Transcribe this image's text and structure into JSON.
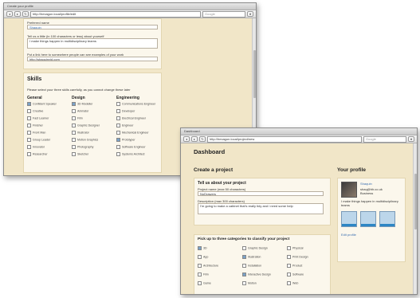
{
  "window1": {
    "title": "Create your profile",
    "url": "http://hexagon.local/profile/edit",
    "search_placeholder": "Google",
    "form": {
      "pref_label": "Preferred name",
      "pref_value": "Shaquin",
      "bio_label": "Tell us a little (in 100 characters or less) about yourself",
      "bio_value": "I make things happen in multidisciplinary teams",
      "link_label": "Put a link here to somewhere people can see examples of your work",
      "link_value": "http://shaquinvid.com"
    },
    "skills": {
      "title": "Skills",
      "instructions": "Please select your three skills carefully, as you cannot change these later",
      "columns": [
        {
          "heading": "General",
          "items": [
            {
              "label": "Confident Speaker",
              "checked": true
            },
            {
              "label": "Creative",
              "checked": false
            },
            {
              "label": "Fast Learner",
              "checked": false
            },
            {
              "label": "Finisher",
              "checked": false
            },
            {
              "label": "Front Man",
              "checked": false
            },
            {
              "label": "Group Leader",
              "checked": false
            },
            {
              "label": "Innovator",
              "checked": false
            },
            {
              "label": "Researcher",
              "checked": false
            }
          ]
        },
        {
          "heading": "Design",
          "items": [
            {
              "label": "3D Modeller",
              "checked": true
            },
            {
              "label": "Animator",
              "checked": false
            },
            {
              "label": "Film",
              "checked": false
            },
            {
              "label": "Graphic Designer",
              "checked": false
            },
            {
              "label": "Illustrator",
              "checked": false
            },
            {
              "label": "Motion Graphics",
              "checked": false
            },
            {
              "label": "Photography",
              "checked": false
            },
            {
              "label": "Sketcher",
              "checked": false
            }
          ]
        },
        {
          "heading": "Engineering",
          "items": [
            {
              "label": "Communications Engineer",
              "checked": false
            },
            {
              "label": "Developer",
              "checked": false
            },
            {
              "label": "Electrical Engineer",
              "checked": false
            },
            {
              "label": "Engineer",
              "checked": false
            },
            {
              "label": "Mechanical Engineer",
              "checked": false
            },
            {
              "label": "Prototyper",
              "checked": true
            },
            {
              "label": "Software Engineer",
              "checked": false
            },
            {
              "label": "Systems Architect",
              "checked": false
            }
          ]
        }
      ]
    }
  },
  "window2": {
    "title": "Dashboard",
    "url": "http://hexagon.local/project/new",
    "search_placeholder": "Google",
    "heading": "Dashboard",
    "create_project": {
      "title": "Create a project",
      "tell_title": "Tell us about your project",
      "name_label": "Project name (max 50 characters)",
      "name_value": "NoDrawers",
      "desc_label": "Description (max 300 characters)",
      "desc_value": "I'm going to make a cabinet that's really tidy and i need some help",
      "categories_title": "Pick up to three categories to classify your project",
      "categories": [
        {
          "label": "3D",
          "checked": true
        },
        {
          "label": "Graphic Design",
          "checked": false
        },
        {
          "label": "Physical",
          "checked": false
        },
        {
          "label": "App",
          "checked": false
        },
        {
          "label": "Illustration",
          "checked": true
        },
        {
          "label": "Print Design",
          "checked": false
        },
        {
          "label": "Architecture",
          "checked": false
        },
        {
          "label": "Installation",
          "checked": false
        },
        {
          "label": "Product",
          "checked": false
        },
        {
          "label": "Film",
          "checked": false
        },
        {
          "label": "Interactive Design",
          "checked": true
        },
        {
          "label": "Software",
          "checked": false
        },
        {
          "label": "Game",
          "checked": false
        },
        {
          "label": "Motion",
          "checked": false
        },
        {
          "label": "Web",
          "checked": false
        }
      ]
    },
    "profile": {
      "title": "Your profile",
      "name": "Shaquin",
      "email": "shaq@hh.co.uk",
      "location": "Business",
      "bio": "I make things happen in multidisciplinary teams",
      "edit_link": "Edit profile"
    }
  }
}
